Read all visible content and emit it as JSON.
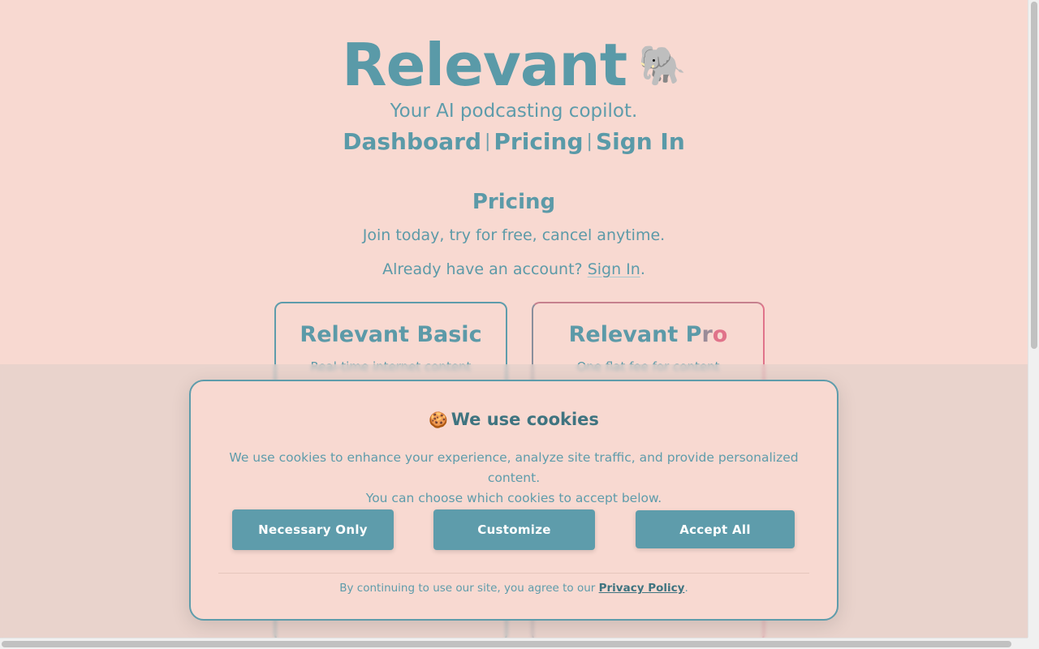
{
  "brand": {
    "name": "Relevant",
    "emoji": "🐘"
  },
  "tagline": "Your AI podcasting copilot.",
  "nav": {
    "items": [
      "Dashboard",
      "Pricing",
      "Sign In"
    ],
    "separator": "|"
  },
  "pricing": {
    "title": "Pricing",
    "subtitle": "Join today, try for free, cancel anytime.",
    "account_prefix": "Already have an account?",
    "account_link": "Sign In",
    "account_suffix": "."
  },
  "plans": [
    {
      "name": "Relevant Basic",
      "description": "Real-time internet content"
    },
    {
      "name_main": "Relevant P",
      "name_r": "r",
      "name_o": "o",
      "description": "One flat fee for content"
    }
  ],
  "cookie_modal": {
    "icon": "🍪",
    "title": "We use cookies",
    "body_line1": "We use cookies to enhance your experience, analyze site traffic, and provide personalized content.",
    "body_line2": "You can choose which cookies to accept below.",
    "buttons": [
      "Necessary Only",
      "Customize",
      "Accept All"
    ],
    "footnote_prefix": "By continuing to use our site, you agree to our",
    "footnote_link": "Privacy Policy",
    "footnote_suffix": "."
  },
  "colors": {
    "background": "#f8d9d1",
    "accent": "#5e9cab",
    "pro_accent": "#e0738a"
  }
}
